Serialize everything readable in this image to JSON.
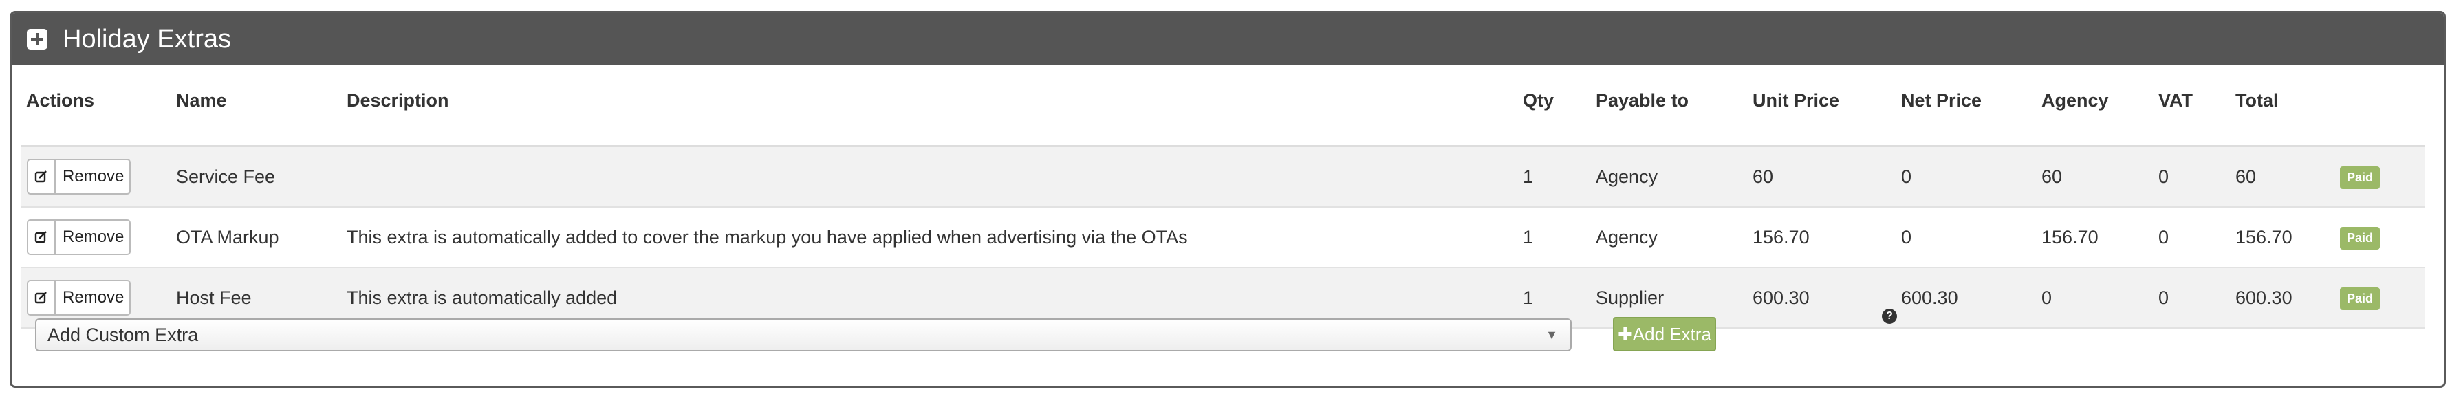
{
  "panel": {
    "title": "Holiday Extras"
  },
  "table": {
    "headers": [
      "Actions",
      "Name",
      "Description",
      "Qty",
      "Payable to",
      "Unit Price",
      "Net Price",
      "Agency",
      "VAT",
      "Total",
      ""
    ],
    "remove_label": "Remove",
    "rows": [
      {
        "name": "Service Fee",
        "description": "",
        "qty": "1",
        "payable_to": "Agency",
        "unit_price": "60",
        "net_price": "0",
        "agency": "60",
        "vat": "0",
        "total": "60",
        "status": "Paid"
      },
      {
        "name": "OTA Markup",
        "description": "This extra is automatically added to cover the markup you have applied when advertising via the OTAs",
        "qty": "1",
        "payable_to": "Agency",
        "unit_price": "156.70",
        "net_price": "0",
        "agency": "156.70",
        "vat": "0",
        "total": "156.70",
        "status": "Paid"
      },
      {
        "name": "Host Fee",
        "description": "This extra is automatically added",
        "qty": "1",
        "payable_to": "Supplier",
        "unit_price": "600.30",
        "net_price": "600.30",
        "agency": "0",
        "vat": "0",
        "total": "600.30",
        "status": "Paid"
      }
    ]
  },
  "footer": {
    "custom_extra_select": "Add Custom Extra",
    "add_extra_label": "✚Add Extra",
    "help_glyph": "?"
  },
  "colors": {
    "header_bg": "#555555",
    "paid_badge": "#9bb967",
    "row_stripe": "#f2f2f2"
  }
}
